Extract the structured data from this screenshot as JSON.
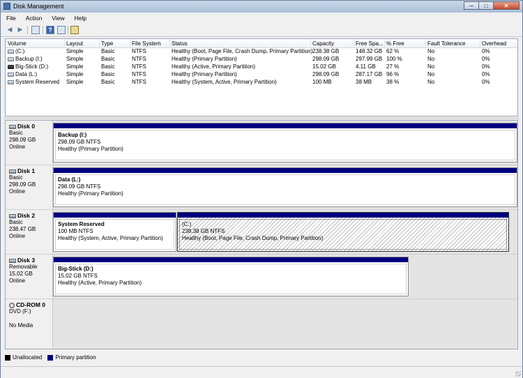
{
  "window": {
    "title": "Disk Management",
    "buttons": [
      "─",
      "□",
      "✕"
    ]
  },
  "menu": [
    "File",
    "Action",
    "View",
    "Help"
  ],
  "toolbar": {
    "icons": [
      "back-arrow-icon",
      "forward-arrow-icon",
      "properties-icon",
      "help-icon",
      "show-hide-icon",
      "refresh-icon"
    ]
  },
  "volume_list": {
    "columns": [
      "Volume",
      "Layout",
      "Type",
      "File System",
      "Status",
      "Capacity",
      "Free Spa...",
      "% Free",
      "Fault Tolerance",
      "Overhead"
    ],
    "rows": [
      {
        "icon": "drive-icon",
        "cells": [
          "(C:)",
          "Simple",
          "Basic",
          "NTFS",
          "Healthy (Boot, Page File, Crash Dump, Primary Partition)",
          "238.38 GB",
          "148.32 GB",
          "62 %",
          "No",
          "0%"
        ]
      },
      {
        "icon": "drive-icon",
        "cells": [
          "Backup (I:)",
          "Simple",
          "Basic",
          "NTFS",
          "Healthy (Primary Partition)",
          "298.09 GB",
          "297.99 GB",
          "100 %",
          "No",
          "0%"
        ]
      },
      {
        "icon": "usb-drive-icon",
        "cells": [
          "Big-Stick (D:)",
          "Simple",
          "Basic",
          "NTFS",
          "Healthy (Active, Primary Partition)",
          "15.02 GB",
          "4.11 GB",
          "27 %",
          "No",
          "0%"
        ]
      },
      {
        "icon": "drive-icon",
        "cells": [
          "Data (L:)",
          "Simple",
          "Basic",
          "NTFS",
          "Healthy (Primary Partition)",
          "298.09 GB",
          "287.17 GB",
          "96 %",
          "No",
          "0%"
        ]
      },
      {
        "icon": "drive-icon",
        "cells": [
          "System Reserved",
          "Simple",
          "Basic",
          "NTFS",
          "Healthy (System, Active, Primary Partition)",
          "100 MB",
          "38 MB",
          "38 %",
          "No",
          "0%"
        ]
      }
    ]
  },
  "disks": [
    {
      "name": "Disk 0",
      "type": "Basic",
      "size": "298.09 GB",
      "state": "Online",
      "partitions": [
        {
          "name": "Backup  (I:)",
          "size": "298.09 GB NTFS",
          "status": "Healthy (Primary Partition)"
        }
      ]
    },
    {
      "name": "Disk 1",
      "type": "Basic",
      "size": "298.09 GB",
      "state": "Online",
      "partitions": [
        {
          "name": "Data  (L:)",
          "size": "298.09 GB NTFS",
          "status": "Healthy (Primary Partition)"
        }
      ]
    },
    {
      "name": "Disk 2",
      "type": "Basic",
      "size": "238.47 GB",
      "state": "Online",
      "partitions": [
        {
          "name": "System Reserved",
          "size": "100 MB NTFS",
          "status": "Healthy (System, Active, Primary Partition)"
        },
        {
          "name": "(C:)",
          "size": "238.38 GB NTFS",
          "status": "Healthy (Boot, Page File, Crash Dump, Primary Partition)",
          "selected": true
        }
      ]
    },
    {
      "name": "Disk 3",
      "type": "Removable",
      "size": "15.02 GB",
      "state": "Online",
      "partitions": [
        {
          "name": "Big-Stick  (D:)",
          "size": "15.02 GB NTFS",
          "status": "Healthy (Active, Primary Partition)"
        }
      ]
    },
    {
      "name": "CD-ROM 0",
      "type": "DVD (F:)",
      "size": "",
      "state": "No Media",
      "partitions": []
    }
  ],
  "legend": [
    {
      "label": "Unallocated",
      "color": "#000000"
    },
    {
      "label": "Primary partition",
      "color": "#000080"
    }
  ]
}
